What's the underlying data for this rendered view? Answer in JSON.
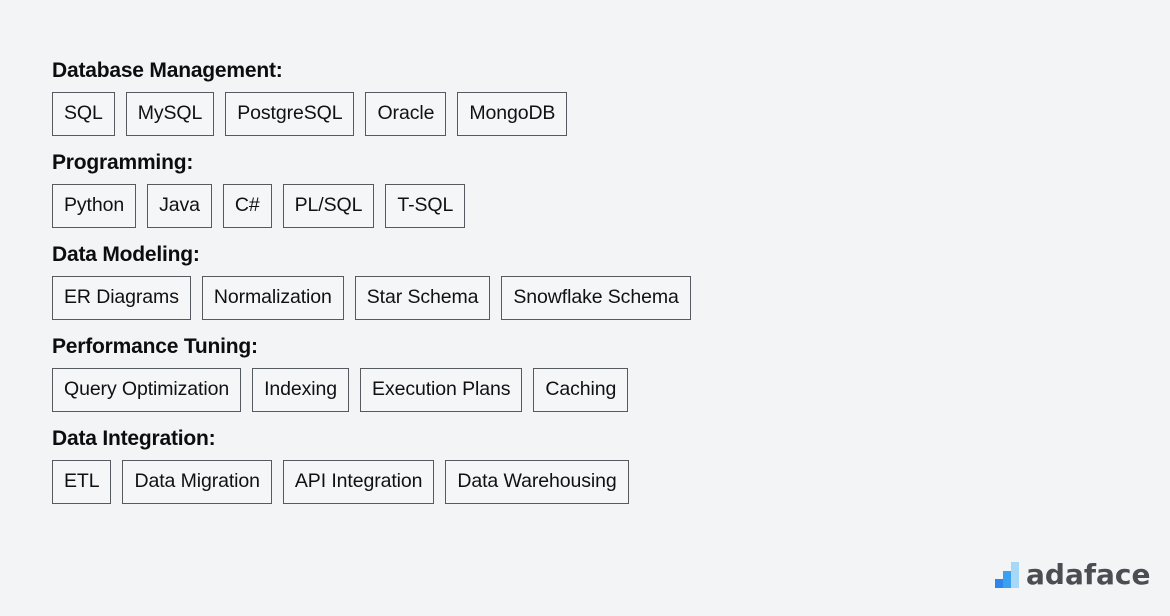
{
  "sections": [
    {
      "title": "Database Management:",
      "tags": [
        "SQL",
        "MySQL",
        "PostgreSQL",
        "Oracle",
        "MongoDB"
      ]
    },
    {
      "title": "Programming:",
      "tags": [
        "Python",
        "Java",
        "C#",
        "PL/SQL",
        "T-SQL"
      ]
    },
    {
      "title": "Data Modeling:",
      "tags": [
        "ER Diagrams",
        "Normalization",
        "Star Schema",
        "Snowflake Schema"
      ]
    },
    {
      "title": "Performance Tuning:",
      "tags": [
        "Query Optimization",
        "Indexing",
        "Execution Plans",
        "Caching"
      ]
    },
    {
      "title": "Data Integration:",
      "tags": [
        "ETL",
        "Data Migration",
        "API Integration",
        "Data Warehousing"
      ]
    }
  ],
  "logo": {
    "icon": "bar-chart-logo-icon",
    "text": "adaface",
    "colors": {
      "bar1": "#2f86e8",
      "bar2": "#3aa0f0",
      "bar3": "#a8d8f8",
      "text": "#4a4d52"
    }
  },
  "theme": {
    "background": "#f3f4f6",
    "tag_border": "#555a60",
    "tag_background": "#f5f6f8",
    "text": "#111111"
  }
}
